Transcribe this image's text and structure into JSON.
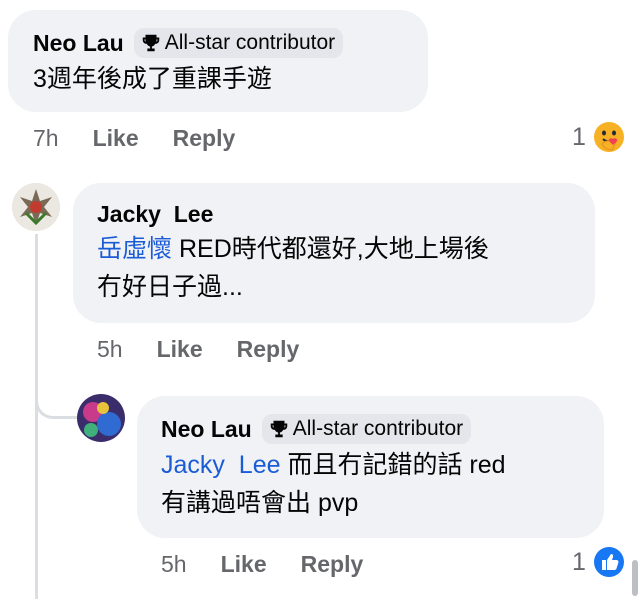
{
  "comments": [
    {
      "author": "Neo Lau",
      "badge": "All-star contributor",
      "text": "3週年後成了重課手遊",
      "time": "7h",
      "like": "Like",
      "reply": "Reply",
      "reaction_count": "1",
      "reaction_icon": "care-reaction-icon"
    },
    {
      "author": "Jacky  Lee",
      "mention": "岳虛懷",
      "text_line1": " RED時代都還好,大地上場後",
      "text_line2": "冇好日子過...",
      "time": "5h",
      "like": "Like",
      "reply": "Reply"
    },
    {
      "author": "Neo Lau",
      "badge": "All-star contributor",
      "mention": "Jacky  Lee",
      "text_line1": " 而且冇記錯的話 red",
      "text_line2": "有講過唔會出 pvp",
      "time": "5h",
      "like": "Like",
      "reply": "Reply",
      "reaction_count": "1",
      "reaction_icon": "like-reaction-icon"
    }
  ],
  "colors": {
    "bubble": "#f0f2f5",
    "badge": "#e4e6eb",
    "mention": "#1a5bd6",
    "meta": "#65676b",
    "like_blue": "#1877f2"
  }
}
